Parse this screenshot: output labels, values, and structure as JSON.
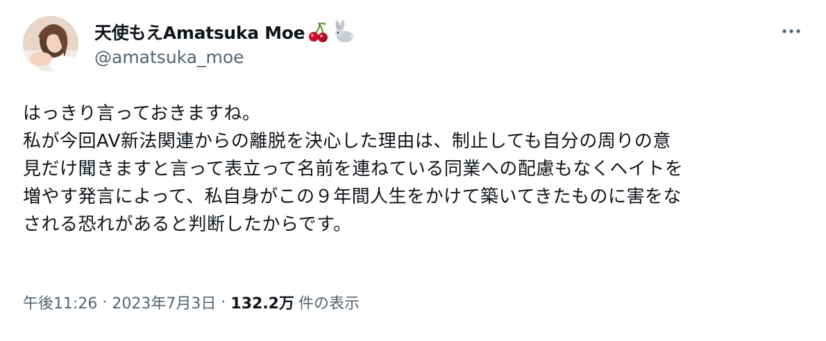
{
  "author": {
    "display_name": "天使もえAmatsuka Moe",
    "handle": "@amatsuka_moe",
    "emoji_icons": [
      "cherry-icon",
      "rabbit-icon"
    ]
  },
  "tweet": {
    "lines": [
      "はっきり言っておきますね。",
      "私が今回AV新法関連からの離脱を決心した理由は、制止しても自分の周りの意",
      "見だけ聞きますと言って表立って名前を連ねている同業への配慮もなくヘイトを",
      "増やす発言によって、私自身がこの９年間人生をかけて築いてきたものに害をな",
      "される恐れがあると判断したからです。"
    ]
  },
  "meta": {
    "time": "午後11:26",
    "separator": "·",
    "date": "2023年7月3日",
    "views_count": "132.2万",
    "views_label": "件の表示"
  },
  "colors": {
    "text_primary": "#0f1419",
    "text_secondary": "#536471",
    "cherry": "#c8102e",
    "background": "#ffffff"
  }
}
